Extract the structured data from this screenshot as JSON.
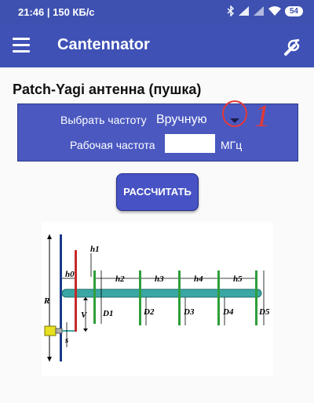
{
  "status_bar": {
    "time_speed": "21:46 | 150 КБ/с",
    "battery": "54"
  },
  "app_bar": {
    "title": "Cantennator"
  },
  "page": {
    "title": "Patch-Yagi антенна (пушка)"
  },
  "form": {
    "freq_select_label": "Выбрать частоту",
    "freq_select_value": "Вручную",
    "work_freq_label": "Рабочая частота",
    "work_freq_value": "",
    "work_freq_unit": "МГц"
  },
  "calc_button": {
    "label": "РАССЧИТАТЬ"
  },
  "annotation": {
    "text": "1"
  },
  "diagram": {
    "labels": {
      "R": "R",
      "V": "V",
      "s": "s",
      "h0": "h0",
      "h1": "h1",
      "h2": "h2",
      "h3": "h3",
      "h4": "h4",
      "h5": "h5",
      "D1": "D1",
      "D2": "D2",
      "D3": "D3",
      "D4": "D4",
      "D5": "D5"
    }
  },
  "colors": {
    "app_bar": "#3f51b5",
    "panel": "#4a58c0",
    "boom": "#3aa7a5",
    "driven": "#c62828",
    "director": "#2e9e3a",
    "annotation": "#e53935"
  },
  "icons": [
    "hamburger-menu-icon",
    "wrench-icon",
    "bluetooth-icon",
    "signal-icon",
    "wifi-icon",
    "dropdown-arrow-icon"
  ]
}
